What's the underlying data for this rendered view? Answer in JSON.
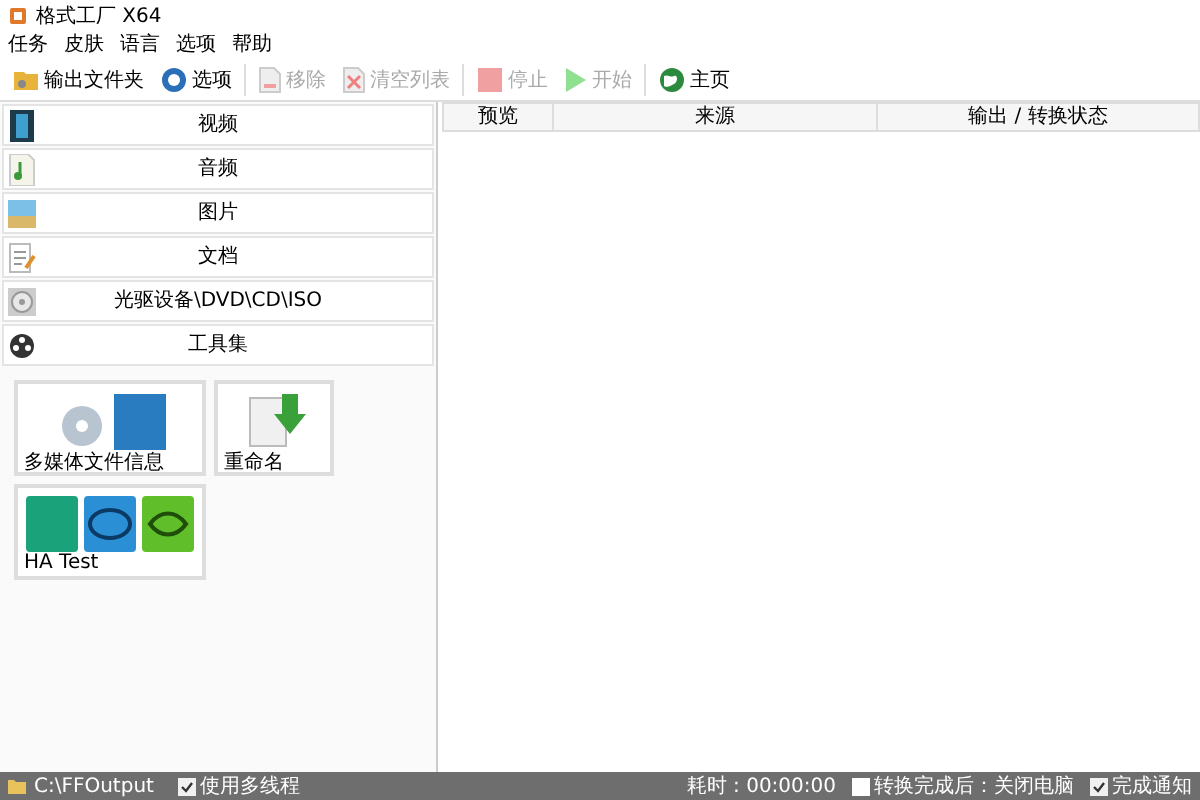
{
  "window": {
    "title": "格式工厂 X64"
  },
  "menu": [
    "任务",
    "皮肤",
    "语言",
    "选项",
    "帮助"
  ],
  "toolbar": [
    {
      "label": "输出文件夹",
      "disabled": false
    },
    {
      "label": "选项",
      "disabled": false
    },
    {
      "label": "移除",
      "disabled": true
    },
    {
      "label": "清空列表",
      "disabled": true
    },
    {
      "label": "停止",
      "disabled": true
    },
    {
      "label": "开始",
      "disabled": true
    },
    {
      "label": "主页",
      "disabled": false
    }
  ],
  "categories": [
    "视频",
    "音频",
    "图片",
    "文档",
    "光驱设备\\DVD\\CD\\ISO",
    "工具集"
  ],
  "tools": [
    "多媒体文件信息",
    "重命名",
    "HA Test"
  ],
  "table": {
    "columns": [
      "预览",
      "来源",
      "输出 / 转换状态"
    ]
  },
  "status_bar": {
    "folder": "C:\\FFOutput",
    "multithread": {
      "label": "使用多线程",
      "checked": true
    },
    "elapsed": "耗时 : 00:00:00",
    "shutdown": {
      "label": "转换完成后：关闭电脑",
      "checked": false
    },
    "notify": {
      "label": "完成通知",
      "checked": true
    }
  }
}
